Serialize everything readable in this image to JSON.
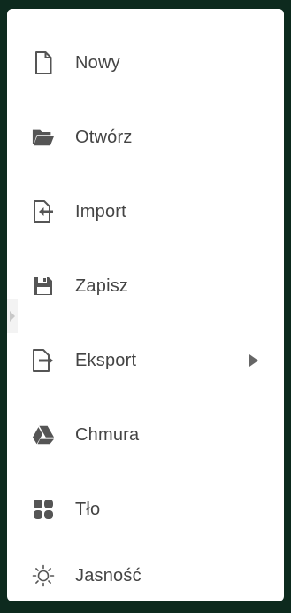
{
  "menu": {
    "items": [
      {
        "label": "Nowy",
        "icon": "new-file-icon"
      },
      {
        "label": "Otwórz",
        "icon": "folder-open-icon"
      },
      {
        "label": "Import",
        "icon": "import-icon"
      },
      {
        "label": "Zapisz",
        "icon": "save-icon"
      },
      {
        "label": "Eksport",
        "icon": "export-icon",
        "submenu": true
      },
      {
        "label": "Chmura",
        "icon": "cloud-drive-icon"
      },
      {
        "label": "Tło",
        "icon": "background-icon"
      },
      {
        "label": "Jasność",
        "icon": "brightness-icon"
      }
    ]
  },
  "colors": {
    "background": "#0d2a1e",
    "panel": "#ffffff",
    "icon": "#555555",
    "text": "#444444"
  }
}
